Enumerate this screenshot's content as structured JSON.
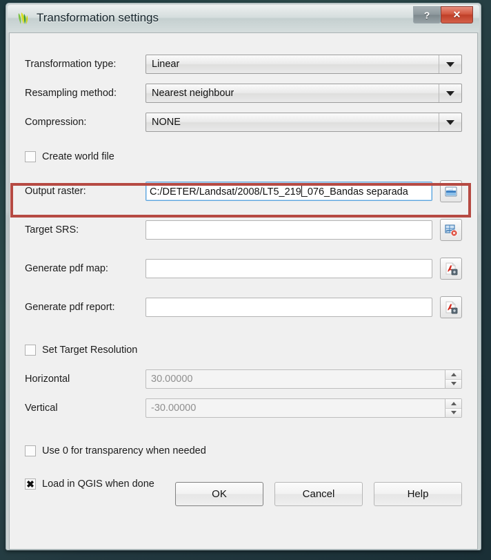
{
  "window": {
    "title": "Transformation settings",
    "app_icon": "qgis-leaf-icon",
    "help_button": "?",
    "close_button": "✕"
  },
  "form": {
    "transformation_type": {
      "label": "Transformation type:",
      "value": "Linear"
    },
    "resampling_method": {
      "label": "Resampling method:",
      "value": "Nearest neighbour"
    },
    "compression": {
      "label": "Compression:",
      "value": "NONE"
    },
    "create_world_file": {
      "label": "Create world file",
      "checked": false,
      "mark": ""
    },
    "output_raster": {
      "label": "Output raster:",
      "value_before_caret": "C:/DETER/Landsat/2008/LT5_219",
      "value_after_caret": "_076_Bandas separada",
      "browse_icon": "open-folder-icon"
    },
    "target_srs": {
      "label": "Target SRS:",
      "value": "",
      "icon": "crs-select-icon"
    },
    "generate_pdf_map": {
      "label": "Generate pdf map:",
      "value": "",
      "icon": "pdf-file-icon"
    },
    "generate_pdf_report": {
      "label": "Generate pdf report:",
      "value": "",
      "icon": "pdf-file-icon"
    },
    "set_target_resolution": {
      "label": "Set Target Resolution",
      "checked": false,
      "mark": ""
    },
    "horizontal": {
      "label": "Horizontal",
      "value": "30.00000"
    },
    "vertical": {
      "label": "Vertical",
      "value": "-30.00000"
    },
    "use_zero_transparency": {
      "label": "Use 0 for transparency when needed",
      "checked": false,
      "mark": ""
    },
    "load_in_qgis": {
      "label": "Load in QGIS when done",
      "checked": true,
      "mark": "✖"
    }
  },
  "buttons": {
    "ok": "OK",
    "cancel": "Cancel",
    "help": "Help"
  },
  "annotation": {
    "color": "#b64a43",
    "target": "output-raster-row"
  }
}
